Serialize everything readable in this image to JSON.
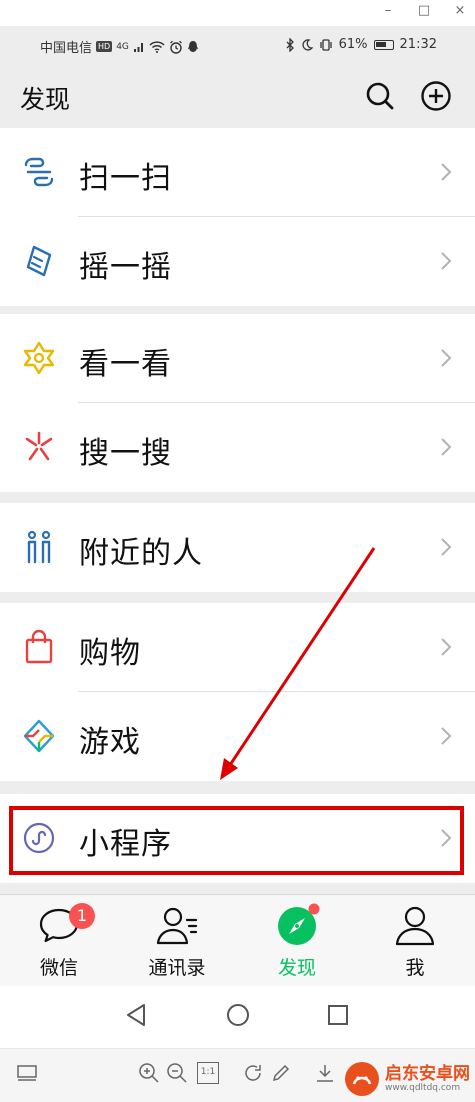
{
  "window_controls": {
    "minimize": "–",
    "maximize": "□",
    "close": "×"
  },
  "status_bar": {
    "carrier": "中国电信",
    "hd": "HD",
    "network": "4G",
    "battery": "61%",
    "time": "21:32"
  },
  "header": {
    "title": "发现",
    "search_icon": "search-icon",
    "add_icon": "plus-circle-icon"
  },
  "groups": [
    {
      "items": [
        {
          "label": "扫一扫",
          "icon": "scan-icon"
        },
        {
          "label": "摇一摇",
          "icon": "shake-icon"
        }
      ]
    },
    {
      "items": [
        {
          "label": "看一看",
          "icon": "look-icon"
        },
        {
          "label": "搜一搜",
          "icon": "search-spark-icon"
        }
      ]
    },
    {
      "items": [
        {
          "label": "附近的人",
          "icon": "people-nearby-icon"
        }
      ]
    },
    {
      "items": [
        {
          "label": "购物",
          "icon": "shopping-bag-icon"
        },
        {
          "label": "游戏",
          "icon": "game-icon"
        }
      ]
    },
    {
      "items": [
        {
          "label": "小程序",
          "icon": "mini-program-icon"
        }
      ]
    }
  ],
  "tabs": [
    {
      "label": "微信",
      "icon": "chat-icon",
      "badge": "1",
      "active": false
    },
    {
      "label": "通讯录",
      "icon": "contacts-icon",
      "active": false
    },
    {
      "label": "发现",
      "icon": "compass-icon",
      "active": true
    },
    {
      "label": "我",
      "icon": "person-icon",
      "active": false
    }
  ],
  "viewer_toolbar": {
    "fit_label": "1:1"
  },
  "watermark": {
    "brand": "启东安卓网",
    "url": "www.qdltdq.com"
  },
  "colors": {
    "accent": "#07c160",
    "badge": "#fa5151",
    "highlight": "#dd0000",
    "background": "#ededed"
  }
}
